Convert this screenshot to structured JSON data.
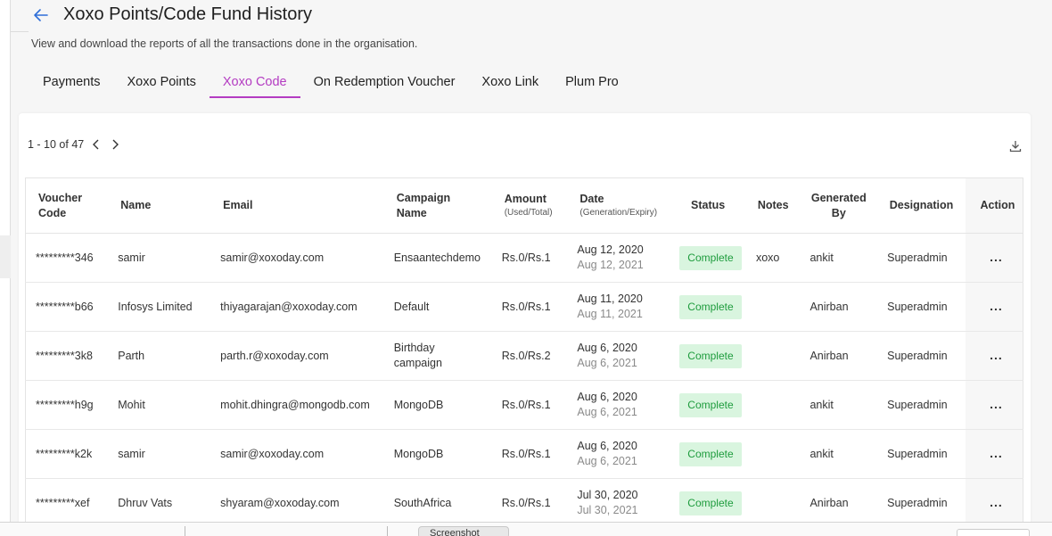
{
  "header": {
    "title": "Xoxo Points/Code Fund History",
    "subtitle": "View and download the reports of all the transactions done in the organisation."
  },
  "tabs": [
    {
      "label": "Payments"
    },
    {
      "label": "Xoxo Points"
    },
    {
      "label": "Xoxo Code"
    },
    {
      "label": "On Redemption Voucher"
    },
    {
      "label": "Xoxo Link"
    },
    {
      "label": "Plum Pro"
    }
  ],
  "active_tab": "Xoxo Code",
  "pagination": {
    "text": "1 - 10 of 47"
  },
  "table": {
    "headers": {
      "voucher_code": [
        "Voucher",
        "Code"
      ],
      "name": "Name",
      "email": "Email",
      "campaign": [
        "Campaign",
        "Name"
      ],
      "amount": "Amount",
      "amount_sub": "(Used/Total)",
      "date": "Date",
      "date_sub": "(Generation/Expiry)",
      "status": "Status",
      "notes": "Notes",
      "generated_by": [
        "Generated",
        "By"
      ],
      "designation": "Designation",
      "action": "Action"
    },
    "rows": [
      {
        "code": "*********346",
        "name": "samir",
        "email": "samir@xoxoday.com",
        "campaign": [
          "Ensaantechdemo"
        ],
        "amount": "Rs.0/Rs.1",
        "date_gen": "Aug 12, 2020",
        "date_exp": "Aug 12, 2021",
        "status": "Complete",
        "notes": "xoxo",
        "generated_by": "ankit",
        "designation": "Superadmin",
        "action": "..."
      },
      {
        "code": "*********b66",
        "name": "Infosys Limited",
        "email": "thiyagarajan@xoxoday.com",
        "campaign": [
          "Default"
        ],
        "amount": "Rs.0/Rs.1",
        "date_gen": "Aug 11, 2020",
        "date_exp": "Aug 11, 2021",
        "status": "Complete",
        "notes": "",
        "generated_by": "Anirban",
        "designation": "Superadmin",
        "action": "..."
      },
      {
        "code": "*********3k8",
        "name": "Parth",
        "email": "parth.r@xoxoday.com",
        "campaign": [
          "Birthday",
          "campaign"
        ],
        "amount": "Rs.0/Rs.2",
        "date_gen": "Aug 6, 2020",
        "date_exp": "Aug 6, 2021",
        "status": "Complete",
        "notes": "",
        "generated_by": "Anirban",
        "designation": "Superadmin",
        "action": "..."
      },
      {
        "code": "*********h9g",
        "name": "Mohit",
        "email": "mohit.dhingra@mongodb.com",
        "campaign": [
          "MongoDB"
        ],
        "amount": "Rs.0/Rs.1",
        "date_gen": "Aug 6, 2020",
        "date_exp": "Aug 6, 2021",
        "status": "Complete",
        "notes": "",
        "generated_by": "ankit",
        "designation": "Superadmin",
        "action": "..."
      },
      {
        "code": "*********k2k",
        "name": "samir",
        "email": "samir@xoxoday.com",
        "campaign": [
          "MongoDB"
        ],
        "amount": "Rs.0/Rs.1",
        "date_gen": "Aug 6, 2020",
        "date_exp": "Aug 6, 2021",
        "status": "Complete",
        "notes": "",
        "generated_by": "ankit",
        "designation": "Superadmin",
        "action": "..."
      },
      {
        "code": "*********xef",
        "name": "Dhruv Vats",
        "email": "shyaram@xoxoday.com",
        "campaign": [
          "SouthAfrica"
        ],
        "amount": "Rs.0/Rs.1",
        "date_gen": "Jul 30, 2020",
        "date_exp": "Jul 30, 2021",
        "status": "Complete",
        "notes": "",
        "generated_by": "Anirban",
        "designation": "Superadmin",
        "action": "..."
      }
    ]
  },
  "bottom_bar": {
    "button_label": "Screenshot"
  },
  "icons": {
    "back": "arrow-left-icon",
    "prev": "chevron-left-icon",
    "next": "chevron-right-icon",
    "download": "download-icon"
  },
  "colors": {
    "accent": "#b43cc2",
    "status_bg": "#d9f5df",
    "status_text": "#1e9c3d"
  }
}
